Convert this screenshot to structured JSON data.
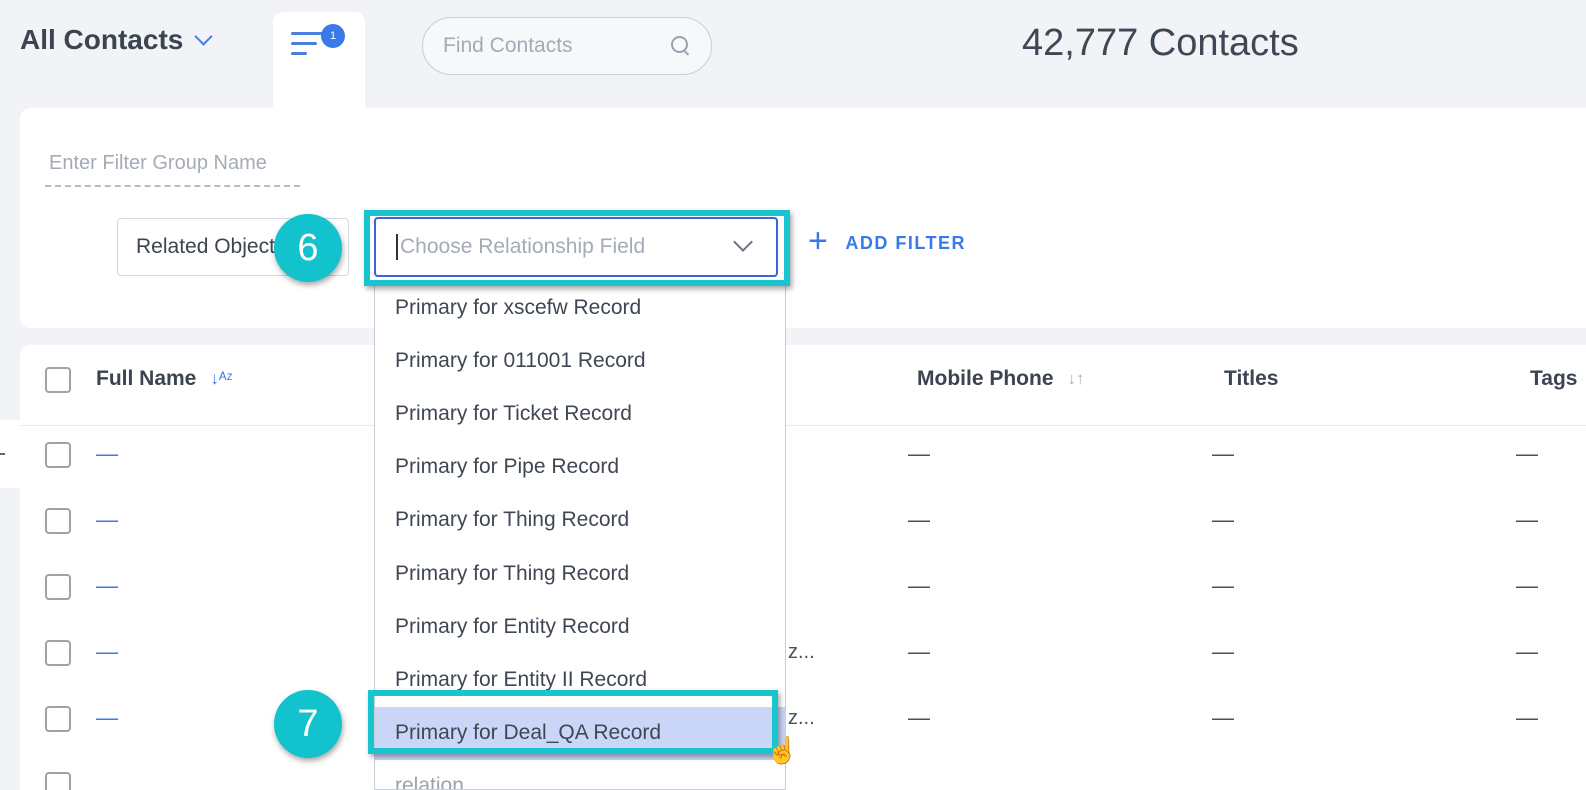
{
  "header": {
    "view_title": "All Contacts",
    "filter_badge": "1",
    "search_placeholder": "Find Contacts",
    "contact_count": "42,777 Contacts"
  },
  "filter_panel": {
    "group_name_placeholder": "Enter Filter Group Name",
    "related_object_value": "Related Objects",
    "relationship_placeholder": "Choose Relationship Field",
    "add_filter_label": "ADD FILTER"
  },
  "dropdown": {
    "items": [
      "Primary for xscefw Record",
      "Primary for 011001 Record",
      "Primary for Ticket Record",
      "Primary for Pipe Record",
      "Primary for Thing Record",
      "Primary for Thing Record",
      "Primary for Entity Record",
      "Primary for Entity II Record",
      "Primary for Deal_QA Record",
      "relation"
    ],
    "highlighted_index": 8
  },
  "table": {
    "columns": {
      "full_name": "Full Name",
      "mobile_phone": "Mobile Phone",
      "titles": "Titles",
      "tags": "Tags"
    },
    "empty_value": "—",
    "truncated_value": "z..."
  },
  "annotations": {
    "step_6": "6",
    "step_7": "7",
    "highlight_color": "#18c5cf"
  },
  "colors": {
    "accent": "#3a7ae8",
    "highlight_row": "#c9d6f7"
  }
}
